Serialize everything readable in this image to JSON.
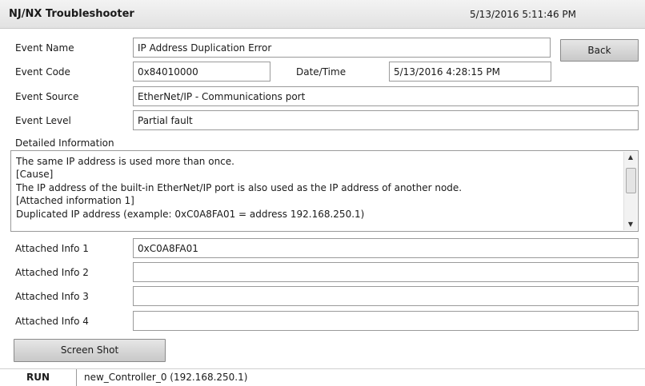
{
  "header": {
    "title": "NJ/NX Troubleshooter",
    "datetime": "5/13/2016 5:11:46 PM"
  },
  "event": {
    "name_label": "Event Name",
    "name_value": "IP Address Duplication Error",
    "code_label": "Event Code",
    "code_value": "0x84010000",
    "datetime_label": "Date/Time",
    "datetime_value": "5/13/2016 4:28:15 PM",
    "source_label": "Event Source",
    "source_value": "EtherNet/IP - Communications port",
    "level_label": "Event Level",
    "level_value": "Partial fault"
  },
  "buttons": {
    "back": "Back",
    "screenshot": "Screen Shot"
  },
  "details": {
    "label": "Detailed Information",
    "lines": [
      "The same IP address is used more than once.",
      "[Cause]",
      "The IP address of the built-in EtherNet/IP port is also used as the IP address of another node.",
      "[Attached information 1]",
      "Duplicated IP address (example: 0xC0A8FA01 = address 192.168.250.1)"
    ],
    "scroll_up_icon": "triangle-up",
    "scroll_down_icon": "triangle-down"
  },
  "attached": [
    {
      "label": "Attached Info 1",
      "value": "0xC0A8FA01"
    },
    {
      "label": "Attached Info 2",
      "value": ""
    },
    {
      "label": "Attached Info 3",
      "value": ""
    },
    {
      "label": "Attached Info 4",
      "value": ""
    }
  ],
  "status": {
    "mode": "RUN",
    "controller": "new_Controller_0 (192.168.250.1)"
  }
}
